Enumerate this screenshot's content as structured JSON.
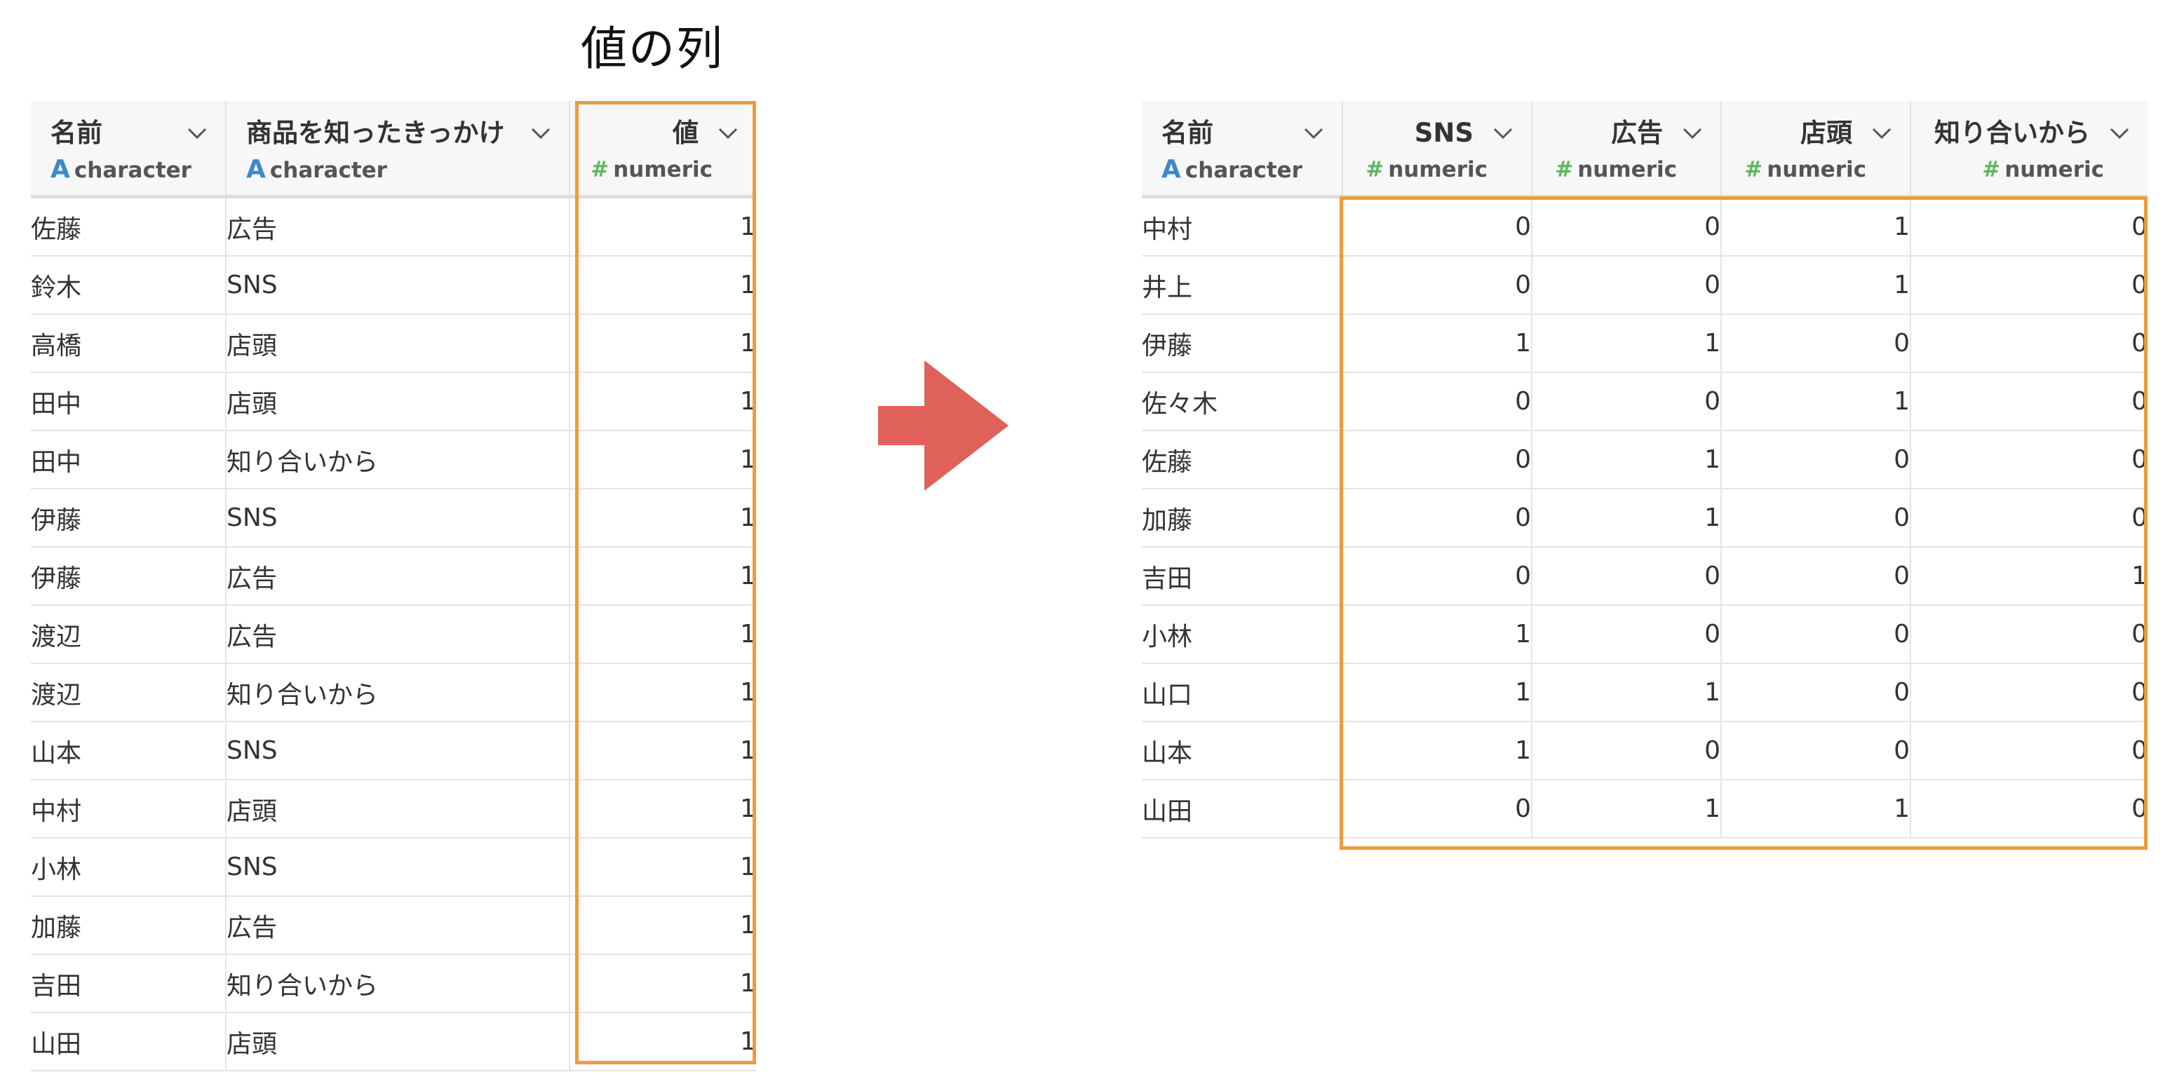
{
  "caption": "値の列",
  "left_table": {
    "columns": [
      {
        "name": "名前",
        "type": "character"
      },
      {
        "name": "商品を知ったきっかけ",
        "type": "character"
      },
      {
        "name": "値",
        "type": "numeric"
      }
    ],
    "rows": [
      [
        "佐藤",
        "広告",
        "1"
      ],
      [
        "鈴木",
        "SNS",
        "1"
      ],
      [
        "高橋",
        "店頭",
        "1"
      ],
      [
        "田中",
        "店頭",
        "1"
      ],
      [
        "田中",
        "知り合いから",
        "1"
      ],
      [
        "伊藤",
        "SNS",
        "1"
      ],
      [
        "伊藤",
        "広告",
        "1"
      ],
      [
        "渡辺",
        "広告",
        "1"
      ],
      [
        "渡辺",
        "知り合いから",
        "1"
      ],
      [
        "山本",
        "SNS",
        "1"
      ],
      [
        "中村",
        "店頭",
        "1"
      ],
      [
        "小林",
        "SNS",
        "1"
      ],
      [
        "加藤",
        "広告",
        "1"
      ],
      [
        "吉田",
        "知り合いから",
        "1"
      ],
      [
        "山田",
        "店頭",
        "1"
      ]
    ]
  },
  "right_table": {
    "columns": [
      {
        "name": "名前",
        "type": "character"
      },
      {
        "name": "SNS",
        "type": "numeric"
      },
      {
        "name": "広告",
        "type": "numeric"
      },
      {
        "name": "店頭",
        "type": "numeric"
      },
      {
        "name": "知り合いから",
        "type": "numeric"
      }
    ],
    "rows": [
      [
        "中村",
        "0",
        "0",
        "1",
        "0"
      ],
      [
        "井上",
        "0",
        "0",
        "1",
        "0"
      ],
      [
        "伊藤",
        "1",
        "1",
        "0",
        "0"
      ],
      [
        "佐々木",
        "0",
        "0",
        "1",
        "0"
      ],
      [
        "佐藤",
        "0",
        "1",
        "0",
        "0"
      ],
      [
        "加藤",
        "0",
        "1",
        "0",
        "0"
      ],
      [
        "吉田",
        "0",
        "0",
        "0",
        "1"
      ],
      [
        "小林",
        "1",
        "0",
        "0",
        "0"
      ],
      [
        "山口",
        "1",
        "1",
        "0",
        "0"
      ],
      [
        "山本",
        "1",
        "0",
        "0",
        "0"
      ],
      [
        "山田",
        "0",
        "1",
        "1",
        "0"
      ]
    ]
  },
  "type_icons": {
    "character": "A",
    "numeric": "#"
  },
  "colors": {
    "highlight": "#ef9b3c",
    "arrow": "#e0605a",
    "character_icon": "#3f88c8",
    "numeric_icon": "#5cb85c"
  }
}
